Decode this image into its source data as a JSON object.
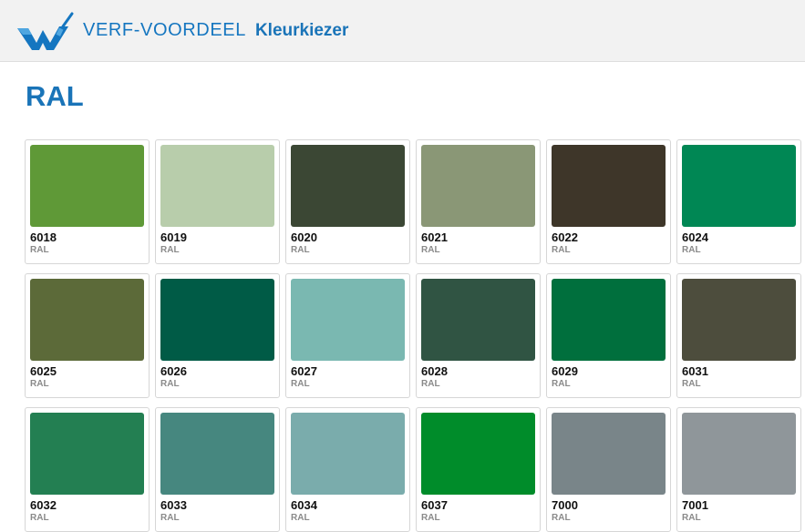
{
  "header": {
    "brand": "VERF-VOORDEEL",
    "subtitle": "Kleurkiezer",
    "logo_icon": "paint-brush-logo-icon",
    "brand_color": "#1576c0"
  },
  "page": {
    "title": "RAL"
  },
  "colors": [
    {
      "code": "6018",
      "type": "RAL",
      "hex": "#5f9937"
    },
    {
      "code": "6019",
      "type": "RAL",
      "hex": "#b8cdab"
    },
    {
      "code": "6020",
      "type": "RAL",
      "hex": "#3b4734"
    },
    {
      "code": "6021",
      "type": "RAL",
      "hex": "#8a9776"
    },
    {
      "code": "6022",
      "type": "RAL",
      "hex": "#3e3629"
    },
    {
      "code": "6024",
      "type": "RAL",
      "hex": "#008754"
    },
    {
      "code": "6025",
      "type": "RAL",
      "hex": "#5c6a39"
    },
    {
      "code": "6026",
      "type": "RAL",
      "hex": "#005b46"
    },
    {
      "code": "6027",
      "type": "RAL",
      "hex": "#7ab8b1"
    },
    {
      "code": "6028",
      "type": "RAL",
      "hex": "#305443"
    },
    {
      "code": "6029",
      "type": "RAL",
      "hex": "#006f3d"
    },
    {
      "code": "6031",
      "type": "RAL",
      "hex": "#4d4d3d"
    },
    {
      "code": "6032",
      "type": "RAL",
      "hex": "#237f52"
    },
    {
      "code": "6033",
      "type": "RAL",
      "hex": "#46877f"
    },
    {
      "code": "6034",
      "type": "RAL",
      "hex": "#7aacac"
    },
    {
      "code": "6037",
      "type": "RAL",
      "hex": "#008c2a"
    },
    {
      "code": "7000",
      "type": "RAL",
      "hex": "#798589"
    },
    {
      "code": "7001",
      "type": "RAL",
      "hex": "#8f969a"
    }
  ]
}
